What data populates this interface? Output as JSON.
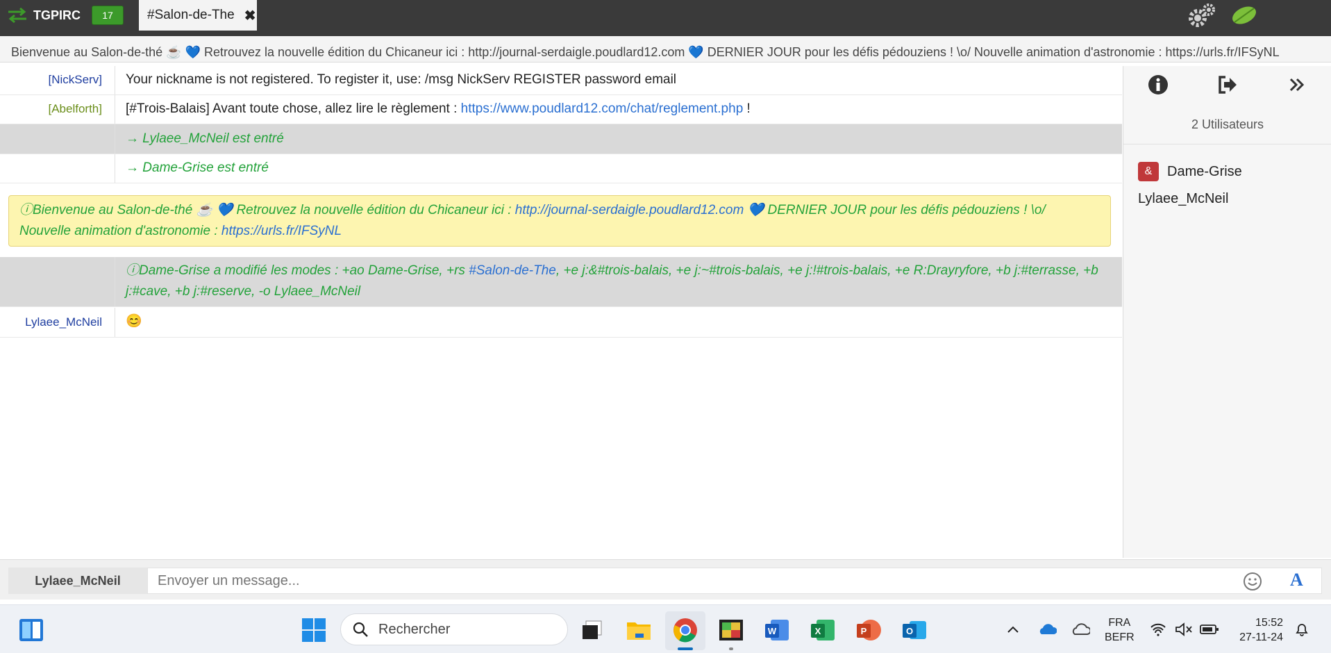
{
  "app": {
    "name": "TGPIRC",
    "unread_count": "17",
    "active_tab": "#Salon-de-The"
  },
  "topic": "Bienvenue au Salon-de-thé ☕ 💙 Retrouvez la nouvelle édition du Chicaneur ici : http://journal-serdaigle.poudlard12.com 💙 DERNIER JOUR pour les défis pédouziens ! \\o/ Nouvelle animation d'astronomie : https://urls.fr/IFSyNL",
  "messages": [
    {
      "nick": "[NickServ]",
      "text": "Your nickname is not registered. To register it, use: /msg NickServ REGISTER password email"
    },
    {
      "nick": "[Abelforth]",
      "text_before": "[#Trois-Balais] Avant toute chose, allez lire le règlement : ",
      "link": "https://www.poudlard12.com/chat/reglement.php",
      "text_after": " !"
    },
    {
      "nick": "",
      "text": "→ Lylaee_McNeil est entré"
    },
    {
      "nick": "",
      "text": "→ Dame-Grise est entré"
    }
  ],
  "notice": {
    "part1": "Bienvenue au Salon-de-thé ☕ 💙 Retrouvez la nouvelle édition du Chicaneur ici : ",
    "link1": "http://journal-serdaigle.poudlard12.com",
    "part2": " 💙 DERNIER JOUR pour les défis pédouziens ! \\o/ Nouvelle animation d'astronomie : ",
    "link2": "https://urls.fr/IFSyNL"
  },
  "mode_change": {
    "part1": "Dame-Grise a modifié les modes : +ao Dame-Grise, +rs ",
    "channel": "#Salon-de-The",
    "part2": ", +e j:&#trois-balais, +e j:~#trois-balais, +e j:!#trois-balais, +e R:Drayryfore, +b j:#terrasse, +b j:#cave, +b j:#reserve, -o Lylaee_McNeil"
  },
  "last_message": {
    "nick": "Lylaee_McNeil",
    "text": "😊"
  },
  "userlist": {
    "count_label": "2 Utilisateurs",
    "users": [
      {
        "prefix": "&",
        "name": "Dame-Grise"
      },
      {
        "prefix": "",
        "name": "Lylaee_McNeil"
      }
    ]
  },
  "input": {
    "nick": "Lylaee_McNeil",
    "placeholder": "Envoyer un message..."
  },
  "taskbar": {
    "search_label": "Rechercher",
    "lang_line1": "FRA",
    "lang_line2": "BEFR",
    "time": "15:52",
    "date": "27-11-24"
  },
  "colors": {
    "nick_nickserv": "#1f3ea0",
    "nick_abelforth": "#6a8e1a",
    "nick_lylaee": "#1f3ea0",
    "join_green": "#23a23a",
    "link_blue": "#2a6fd1",
    "topbar": "#3a3a3a",
    "badge_red": "#c0383a"
  }
}
